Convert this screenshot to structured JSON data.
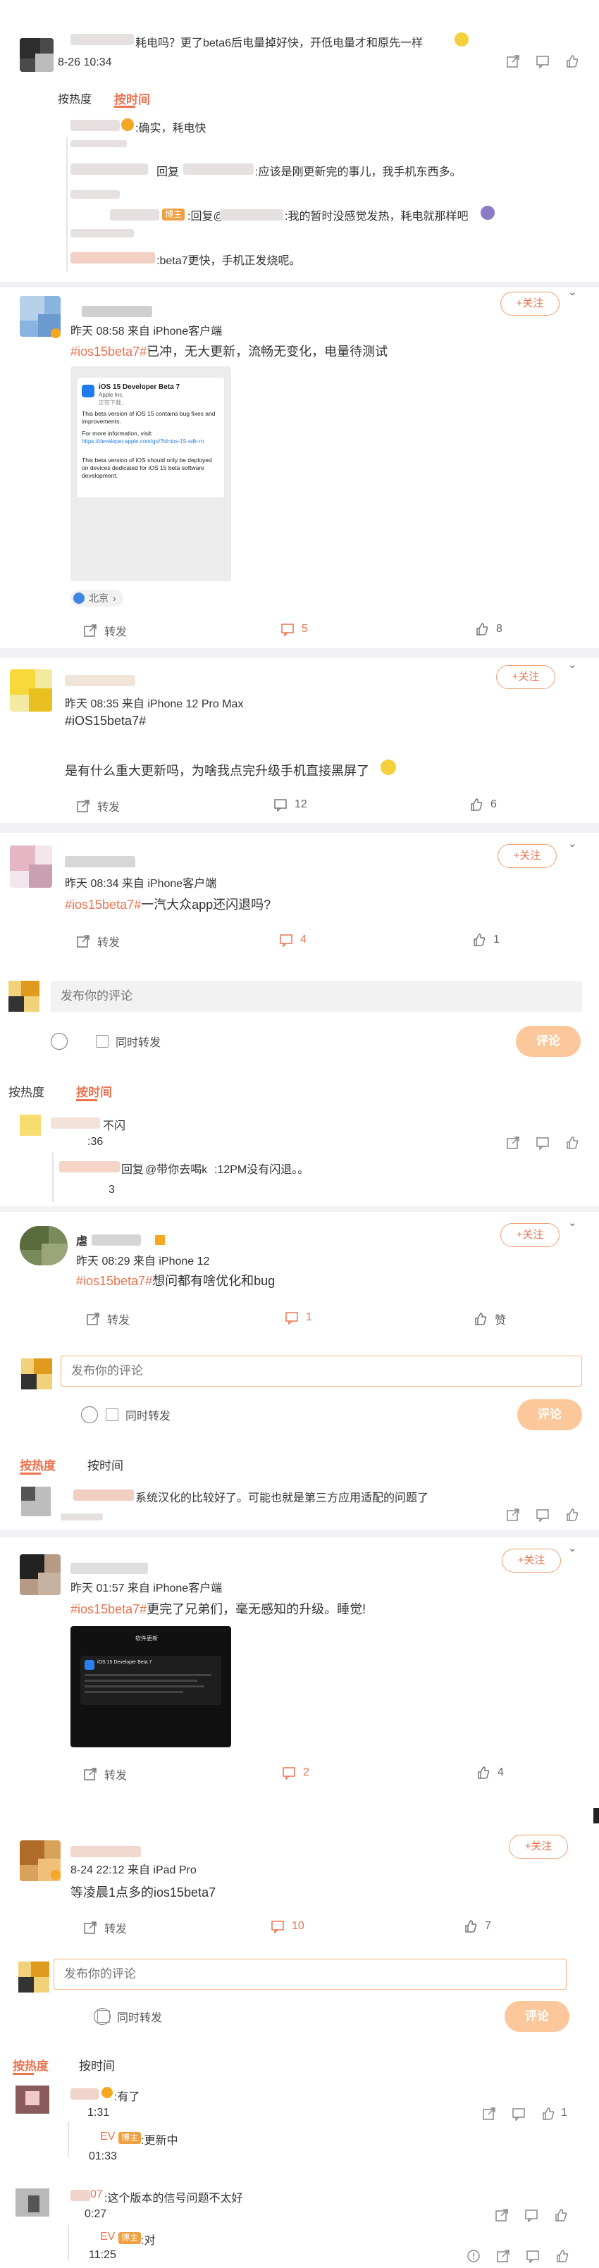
{
  "top_thread": {
    "comment_text": "耗电吗？更了beta6后电量掉好快，开低电量才和原先一样",
    "time": "8-26 10:34",
    "sort_hot": "按热度",
    "sort_time": "按时间",
    "reply1": ":确实，耗电快",
    "reply2_prefix": "回复",
    "reply2_text": ":应该是刚更新完的事儿，我手机东西多。",
    "reply3_prefix": ":回复@",
    "reply3_text": ":我的暂时没感觉发热，耗电就那样吧",
    "reply4_text": ":beta7更快，手机正发烧呢。",
    "badge": "博主"
  },
  "post1": {
    "follow": "+关注",
    "time_source": "昨天 08:58 来自 iPhone客户端",
    "hashtag": "#ios15beta7#",
    "text": "已冲，无大更新，流畅无变化，电量待测试",
    "image": {
      "title": "iOS 15 Developer Beta 7",
      "company": "Apple Inc.",
      "subtitle": "正在下载...",
      "p1": "This beta version of iOS 15 contains bug fixes and improvements.",
      "p2": "For more information, visit:",
      "link": "https://developer.apple.com/go/?id=ios-15-sdk-rn",
      "p3": "This beta version of iOS should only be deployed on devices dedicated for iOS 15 beta software development."
    },
    "location": "北京",
    "repost": "转发",
    "comments": "5",
    "likes": "8"
  },
  "post2": {
    "follow": "+关注",
    "time_source": "昨天 08:35 来自 iPhone 12 Pro Max",
    "hashtag": "#iOS15beta7#",
    "text": "是有什么重大更新吗，为啥我点完升级手机直接黑屏了",
    "repost": "转发",
    "comments": "12",
    "likes": "6"
  },
  "post3": {
    "follow": "+关注",
    "time_source": "昨天 08:34 来自 iPhone客户端",
    "hashtag": "#ios15beta7#",
    "text": "一汽大众app还闪退吗?",
    "repost": "转发",
    "comments": "4",
    "likes": "1",
    "comment_placeholder": "发布你的评论",
    "also_repost": "同时转发",
    "submit": "评论",
    "sort_hot": "按热度",
    "sort_time": "按时间",
    "reply1_text": "不闪",
    "reply1_time": ":36",
    "reply2_prefix": "回复",
    "reply2_mention": "@带你去喝k",
    "reply2_text": ":12PM没有闪退。。",
    "reply2_time": "3"
  },
  "post4": {
    "follow": "+关注",
    "name_prefix": "虐",
    "time_source": "昨天 08:29 来自 iPhone 12",
    "hashtag": "#ios15beta7#",
    "text": "想问都有啥优化和bug",
    "repost": "转发",
    "comments": "1",
    "likes": "赞",
    "comment_placeholder": "发布你的评论",
    "also_repost": "同时转发",
    "submit": "评论",
    "sort_hot": "按热度",
    "sort_time": "按时间",
    "reply_text": "系统汉化的比较好了。可能也就是第三方应用适配的问题了"
  },
  "post5": {
    "follow": "+关注",
    "time_source": "昨天 01:57 来自 iPhone客户端",
    "hashtag": "#ios15beta7#",
    "text": "更完了兄弟们，毫无感知的升级。睡觉!",
    "image": {
      "header": "软件更新",
      "title": "iOS 15 Developer Beta 7"
    },
    "repost": "转发",
    "comments": "2",
    "likes": "4"
  },
  "post6": {
    "follow": "+关注",
    "time_source": "8-24 22:12 来自 iPad Pro",
    "text": "等凌晨1点多的ios15beta7",
    "repost": "转发",
    "comments": "10",
    "likes": "7",
    "comment_placeholder": "发布你的评论",
    "also_repost": "同时转发",
    "submit": "评论",
    "sort_hot": "按热度",
    "sort_time": "按时间",
    "r1_text": ":有了",
    "r1_time": "1:31",
    "r1_like": "1",
    "r2_name": "EV",
    "r2_text": ":更新中",
    "r2_time": "01:33",
    "r3_name": "07",
    "r3_text": ":这个版本的信号问题不太好",
    "r3_time": "0:27",
    "r4_name": "EV",
    "r4_text": ":对",
    "r4_time": "11:25",
    "badge": "博主"
  }
}
